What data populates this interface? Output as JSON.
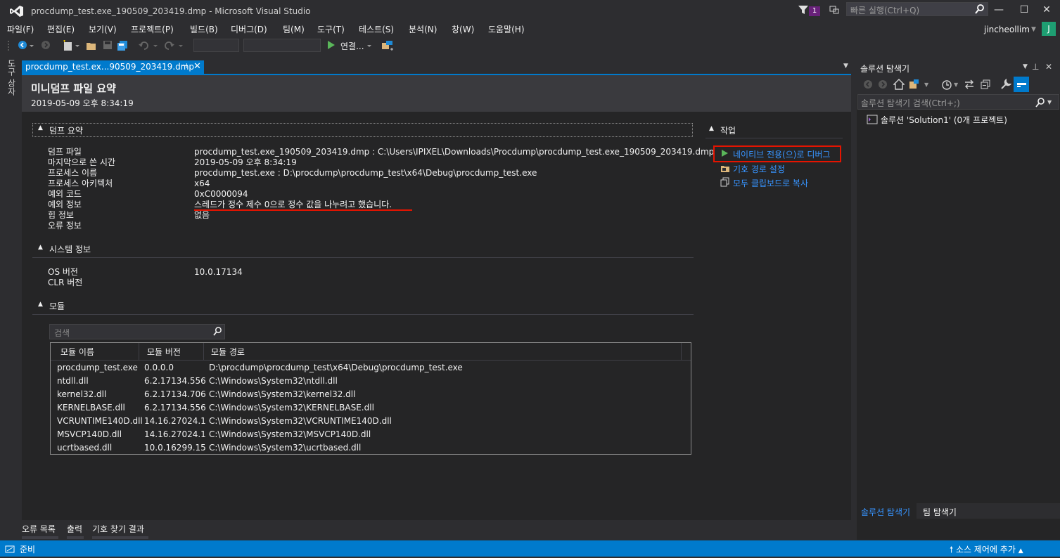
{
  "window": {
    "title": "procdump_test.exe_190509_203419.dmp - Microsoft Visual Studio",
    "notification_count": "1",
    "quick_launch_placeholder": "빠른 실행(Ctrl+Q)",
    "user": "jincheollim",
    "user_initial": "J"
  },
  "menu": [
    "파일(F)",
    "편집(E)",
    "보기(V)",
    "프로젝트(P)",
    "빌드(B)",
    "디버그(D)",
    "팀(M)",
    "도구(T)",
    "테스트(S)",
    "분석(N)",
    "창(W)",
    "도움말(H)"
  ],
  "toolbar": {
    "connect_label": "연결..."
  },
  "left_strip": {
    "toolbox_label": "도구 상자"
  },
  "doc_tab": {
    "label": "procdump_test.ex...90509_203419.dmp"
  },
  "summary": {
    "title": "미니덤프 파일 요약",
    "date": "2019-05-09 오후 8:34:19",
    "dump_section": "덤프 요약",
    "dump_rows": [
      {
        "key": "덤프 파일",
        "value": "procdump_test.exe_190509_203419.dmp : C:\\Users\\IPIXEL\\Downloads\\Procdump\\procdump_test.exe_190509_203419.dmp"
      },
      {
        "key": "마지막으로 쓴 시간",
        "value": "2019-05-09 오후 8:34:19"
      },
      {
        "key": "프로세스 이름",
        "value": "procdump_test.exe : D:\\procdump\\procdump_test\\x64\\Debug\\procdump_test.exe"
      },
      {
        "key": "프로세스 아키텍처",
        "value": "x64"
      },
      {
        "key": "예외 코드",
        "value": "0xC0000094"
      },
      {
        "key": "예외 정보",
        "value": "스레드가 정수 제수 0으로 정수 값을 나누려고 했습니다."
      },
      {
        "key": "힙 정보",
        "value": "없음"
      },
      {
        "key": "오류 정보",
        "value": ""
      }
    ],
    "system_section": "시스템 정보",
    "system_rows": [
      {
        "key": "OS 버전",
        "value": "10.0.17134"
      },
      {
        "key": "CLR 버전",
        "value": ""
      }
    ],
    "modules_section": "모듈",
    "module_search_placeholder": "검색",
    "module_columns": [
      "모듈 이름",
      "모듈 버전",
      "모듈 경로"
    ],
    "modules": [
      {
        "name": "procdump_test.exe",
        "version": "0.0.0.0",
        "path": "D:\\procdump\\procdump_test\\x64\\Debug\\procdump_test.exe"
      },
      {
        "name": "ntdll.dll",
        "version": "6.2.17134.556",
        "path": "C:\\Windows\\System32\\ntdll.dll"
      },
      {
        "name": "kernel32.dll",
        "version": "6.2.17134.706",
        "path": "C:\\Windows\\System32\\kernel32.dll"
      },
      {
        "name": "KERNELBASE.dll",
        "version": "6.2.17134.556",
        "path": "C:\\Windows\\System32\\KERNELBASE.dll"
      },
      {
        "name": "VCRUNTIME140D.dll",
        "version": "14.16.27024.1",
        "path": "C:\\Windows\\System32\\VCRUNTIME140D.dll"
      },
      {
        "name": "MSVCP140D.dll",
        "version": "14.16.27024.1",
        "path": "C:\\Windows\\System32\\MSVCP140D.dll"
      },
      {
        "name": "ucrtbased.dll",
        "version": "10.0.16299.15",
        "path": "C:\\Windows\\System32\\ucrtbased.dll"
      }
    ]
  },
  "actions": {
    "title": "작업",
    "items": [
      "네이티브 전용(으)로 디버그",
      "기호 경로 설정",
      "모두 클립보드로 복사"
    ]
  },
  "solution_explorer": {
    "title": "솔루션 탐색기",
    "search_placeholder": "솔루션 탐색기 검색(Ctrl+;)",
    "solution_label": "솔루션 'Solution1' (0개 프로젝트)",
    "tabs": [
      "솔루션 탐색기",
      "팀 탐색기"
    ]
  },
  "bottom_tabs": [
    "오류 목록",
    "출력",
    "기호 찾기 결과"
  ],
  "status": {
    "text": "준비",
    "source_control": "소스 제어에 추가"
  },
  "colors": {
    "accent": "#007acc",
    "link": "#3794ff",
    "highlight": "#e51400",
    "background": "#2d2d30"
  }
}
